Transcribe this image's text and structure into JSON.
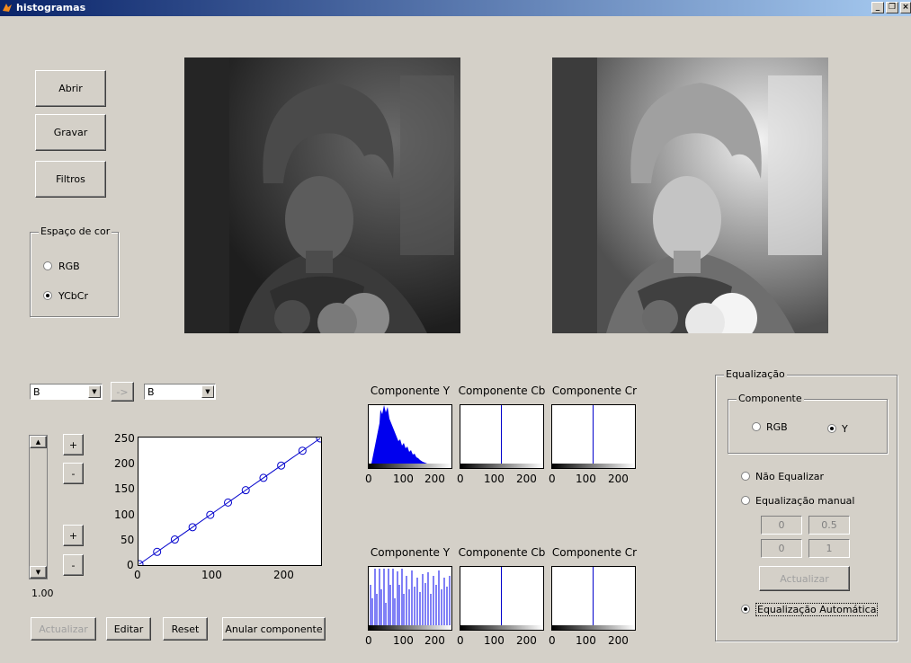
{
  "window": {
    "title": "histogramas",
    "controls": [
      "_",
      "❐",
      "×"
    ]
  },
  "buttons": {
    "open": "Abrir",
    "save": "Gravar",
    "filters": "Filtros",
    "arrow": "->",
    "update_left": "Actualizar",
    "edit": "Editar",
    "reset": "Reset",
    "cancel_component": "Anular componente",
    "plus": "+",
    "minus": "-",
    "update_right": "Actualizar"
  },
  "color_space": {
    "label": "Espaço de cor",
    "options": [
      "RGB",
      "YCbCr"
    ],
    "selected": "YCbCr"
  },
  "combos": {
    "left": "B",
    "right": "B"
  },
  "slider_value": "1.00",
  "curve_chart": {
    "yticks": [
      "250",
      "200",
      "150",
      "100",
      "50",
      "0"
    ],
    "xticks": [
      "0",
      "100",
      "200"
    ]
  },
  "hist_titles_top": [
    "Componente Y",
    "Componente Cb",
    "Componente Cr"
  ],
  "hist_titles_bottom": [
    "Componente Y",
    "Componente Cb",
    "Componente Cr"
  ],
  "hist_xticks": [
    "0",
    "100",
    "200"
  ],
  "equalization": {
    "label": "Equalização",
    "component_label": "Componente",
    "component_options": [
      "RGB",
      "Y"
    ],
    "component_selected": "Y",
    "options": [
      "Não Equalizar",
      "Equalização manual",
      "Equalização Automática"
    ],
    "selected": "Equalização Automática",
    "manual_fields": [
      "0",
      "0.5",
      "0",
      "1"
    ]
  },
  "chart_data": {
    "type": "line",
    "title": "",
    "xlabel": "",
    "ylabel": "",
    "xlim": [
      0,
      255
    ],
    "ylim": [
      0,
      255
    ],
    "x": [
      0,
      25,
      50,
      75,
      100,
      125,
      150,
      175,
      200,
      230,
      255
    ],
    "y": [
      0,
      25,
      50,
      75,
      100,
      125,
      150,
      175,
      200,
      230,
      255
    ],
    "color": "#0000cc"
  }
}
